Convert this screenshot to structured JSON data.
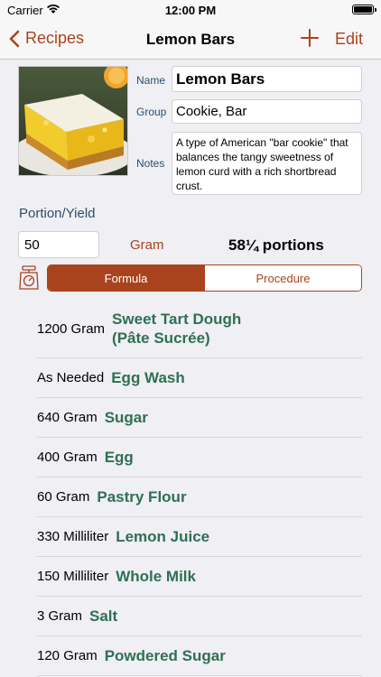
{
  "status": {
    "carrier": "Carrier",
    "time": "12:00 PM"
  },
  "nav": {
    "back_label": "Recipes",
    "title": "Lemon Bars",
    "edit_label": "Edit"
  },
  "recipe": {
    "name_label": "Name",
    "group_label": "Group",
    "notes_label": "Notes",
    "name": "Lemon Bars",
    "group": "Cookie, Bar",
    "notes": "A type of American \"bar cookie\" that balances the tangy sweetness of lemon curd with a rich shortbread crust."
  },
  "portion": {
    "label": "Portion/Yield",
    "value": "50",
    "unit": "Gram",
    "portions": "58¼ portions"
  },
  "segments": {
    "formula": "Formula",
    "procedure": "Procedure",
    "selected": "Formula"
  },
  "ingredients": [
    {
      "qty": "1200 Gram",
      "name": "Sweet Tart Dough\n(Pâte Sucrée)"
    },
    {
      "qty": "As Needed",
      "name": "Egg Wash"
    },
    {
      "qty": "640 Gram",
      "name": "Sugar"
    },
    {
      "qty": "400 Gram",
      "name": "Egg"
    },
    {
      "qty": "60 Gram",
      "name": "Pastry Flour"
    },
    {
      "qty": "330 Milliliter",
      "name": "Lemon Juice"
    },
    {
      "qty": "150 Milliliter",
      "name": "Whole Milk"
    },
    {
      "qty": "3 Gram",
      "name": "Salt"
    },
    {
      "qty": "120 Gram",
      "name": "Powdered Sugar"
    }
  ],
  "colors": {
    "accent": "#a9431e",
    "ingredient": "#2f7052",
    "label": "#2a4f6e",
    "background": "#efeff4"
  },
  "icons": {
    "back": "chevron-left-icon",
    "add": "plus-icon",
    "scale": "scale-icon",
    "wifi": "wifi-icon",
    "battery": "battery-icon"
  }
}
